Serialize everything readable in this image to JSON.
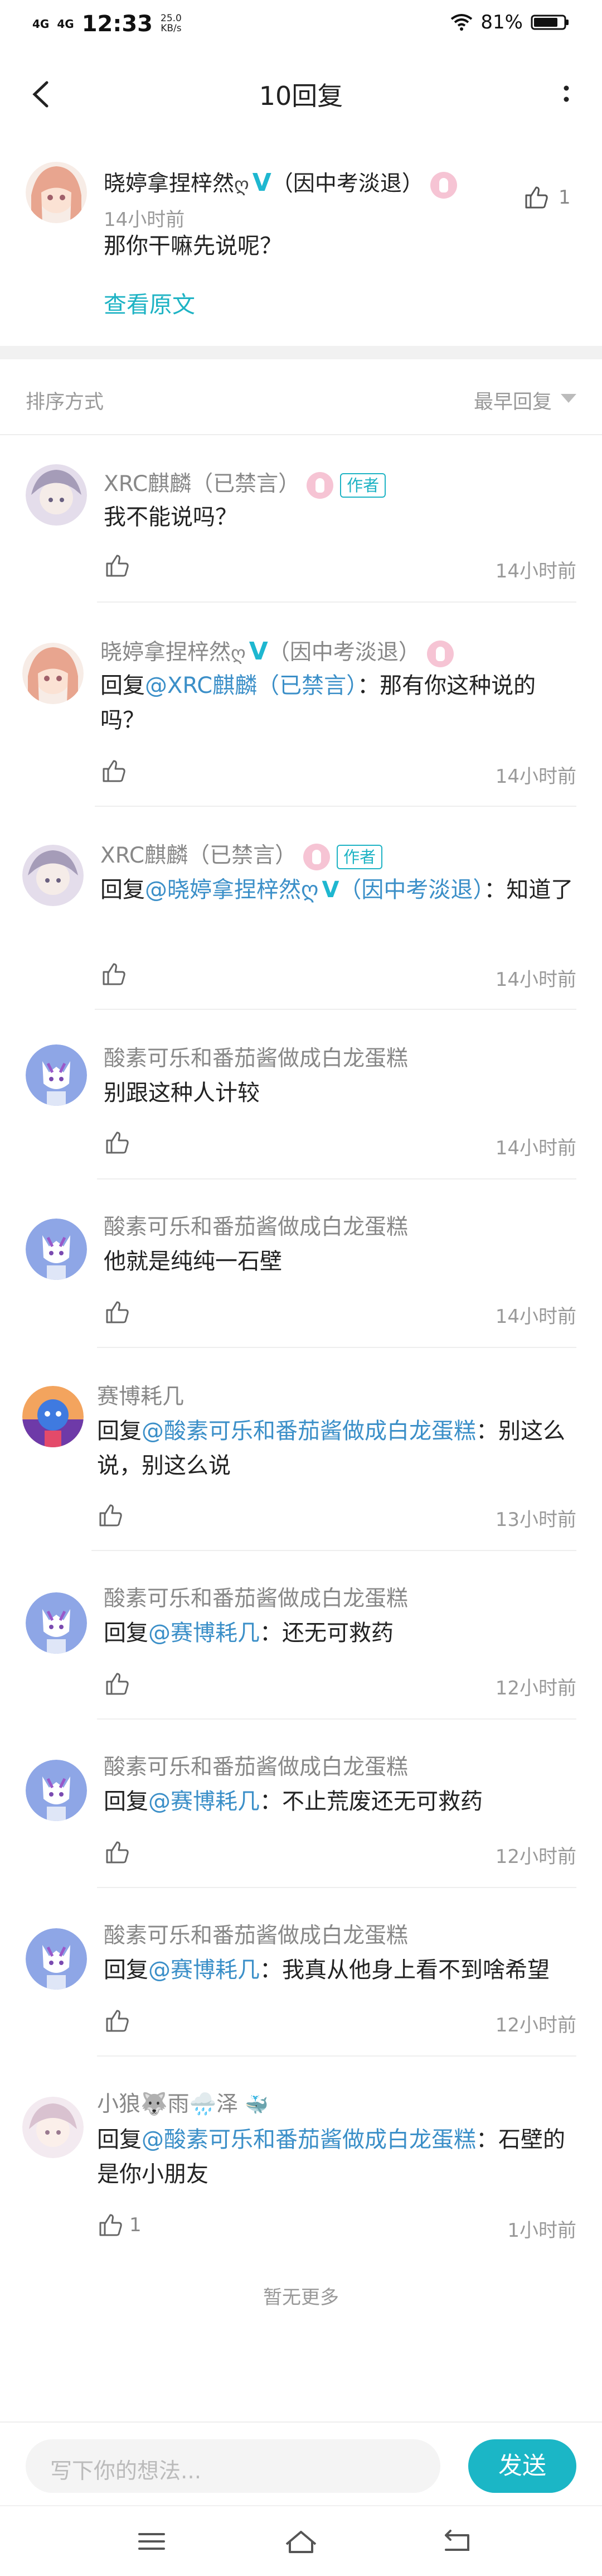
{
  "status_bar": {
    "signal1": "4G",
    "signal2": "4G",
    "time": "12:33",
    "speed_value": "25.0",
    "speed_unit": "KB/s",
    "battery_pct": "81%"
  },
  "header": {
    "title": "10回复"
  },
  "main_post": {
    "name": "晓婷拿捏梓然",
    "name_suffix": "（因中考淡退）",
    "time": "14小时前",
    "content": "那你干嘛先说呢？",
    "view_original": "查看原文",
    "likes": "1"
  },
  "sort": {
    "label": "排序方式",
    "option": "最早回复"
  },
  "comments": [
    {
      "name": "XRC麒麟（已禁言）",
      "is_author": true,
      "author_tag": "作者",
      "reply_prefix": "",
      "reply_to": "",
      "text": "我不能说吗？",
      "time": "14小时前",
      "likes": ""
    },
    {
      "name": "晓婷拿捏梓然",
      "name_suffix": "（因中考淡退）",
      "reply_prefix": "回复",
      "reply_to": "@XRC麒麟（已禁言）",
      "text": "：那有你这种说的吗？",
      "time": "14小时前",
      "likes": ""
    },
    {
      "name": "XRC麒麟（已禁言）",
      "is_author": true,
      "author_tag": "作者",
      "reply_prefix": "回复",
      "reply_to": "@晓婷拿捏梓然",
      "reply_to_suffix": "（因中考淡退）",
      "text": "：知道了",
      "time": "14小时前",
      "likes": ""
    },
    {
      "name": "酸素可乐和番茄酱做成白龙蛋糕",
      "reply_prefix": "",
      "reply_to": "",
      "text": "别跟这种人计较",
      "time": "14小时前",
      "likes": ""
    },
    {
      "name": "酸素可乐和番茄酱做成白龙蛋糕",
      "reply_prefix": "",
      "reply_to": "",
      "text": "他就是纯纯一石壁",
      "time": "14小时前",
      "likes": ""
    },
    {
      "name": "赛博耗几",
      "reply_prefix": "回复",
      "reply_to": "@酸素可乐和番茄酱做成白龙蛋糕",
      "text": "：别这么说，别这么说",
      "time": "13小时前",
      "likes": ""
    },
    {
      "name": "酸素可乐和番茄酱做成白龙蛋糕",
      "reply_prefix": "回复",
      "reply_to": "@赛博耗几",
      "text": "：还无可救药",
      "time": "12小时前",
      "likes": ""
    },
    {
      "name": "酸素可乐和番茄酱做成白龙蛋糕",
      "reply_prefix": "回复",
      "reply_to": "@赛博耗几",
      "text": "：不止荒废还无可救药",
      "time": "12小时前",
      "likes": ""
    },
    {
      "name": "酸素可乐和番茄酱做成白龙蛋糕",
      "reply_prefix": "回复",
      "reply_to": "@赛博耗几",
      "text": "：我真从他身上看不到啥希望",
      "time": "12小时前",
      "likes": ""
    },
    {
      "name": "小狼🐺雨🌧️泽",
      "reply_prefix": "回复",
      "reply_to": "@酸素可乐和番茄酱做成白龙蛋糕",
      "text": "：石壁的是你小朋友",
      "time": "1小时前",
      "likes": "1"
    }
  ],
  "footer": {
    "no_more": "暂无更多",
    "input_placeholder": "写下你的想法...",
    "send": "发送"
  },
  "colors": {
    "accent": "#1bb6c6",
    "link": "#3b8fc8"
  }
}
